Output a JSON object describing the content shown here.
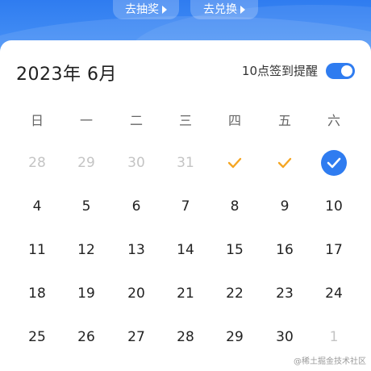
{
  "header": {
    "buttons": [
      {
        "label": "去抽奖"
      },
      {
        "label": "去兑换"
      }
    ]
  },
  "calendar": {
    "title": "2023年 6月",
    "reminder_label": "10点签到提醒",
    "reminder_on": true,
    "accent_color": "#2f7cf0",
    "check_color": "#f5a623",
    "weekdays": [
      "日",
      "一",
      "二",
      "三",
      "四",
      "五",
      "六"
    ],
    "weeks": [
      [
        {
          "label": "28",
          "muted": true
        },
        {
          "label": "29",
          "muted": true
        },
        {
          "label": "30",
          "muted": true
        },
        {
          "label": "31",
          "muted": true
        },
        {
          "label": "",
          "state": "checked",
          "icon": "orange-check-icon"
        },
        {
          "label": "",
          "state": "checked",
          "icon": "orange-check-icon"
        },
        {
          "label": "",
          "state": "today-checked",
          "icon": "blue-circle-check-icon"
        }
      ],
      [
        {
          "label": "4"
        },
        {
          "label": "5"
        },
        {
          "label": "6"
        },
        {
          "label": "7"
        },
        {
          "label": "8"
        },
        {
          "label": "9"
        },
        {
          "label": "10"
        }
      ],
      [
        {
          "label": "11"
        },
        {
          "label": "12"
        },
        {
          "label": "13"
        },
        {
          "label": "14"
        },
        {
          "label": "15"
        },
        {
          "label": "16"
        },
        {
          "label": "17"
        }
      ],
      [
        {
          "label": "18"
        },
        {
          "label": "19"
        },
        {
          "label": "20"
        },
        {
          "label": "21"
        },
        {
          "label": "22"
        },
        {
          "label": "23"
        },
        {
          "label": "24"
        }
      ],
      [
        {
          "label": "25"
        },
        {
          "label": "26"
        },
        {
          "label": "27"
        },
        {
          "label": "28"
        },
        {
          "label": "29"
        },
        {
          "label": "30"
        },
        {
          "label": "1",
          "muted": true
        }
      ]
    ]
  },
  "watermark": "@稀土掘金技术社区"
}
